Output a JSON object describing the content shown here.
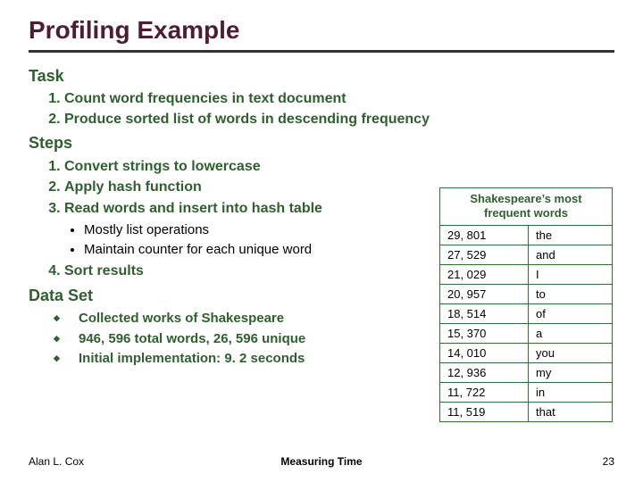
{
  "title": "Profiling Example",
  "sections": {
    "task": {
      "heading": "Task",
      "items": [
        "Count word frequencies in text document",
        "Produce sorted list of words in descending frequency"
      ]
    },
    "steps": {
      "heading": "Steps",
      "items": [
        {
          "text": "Convert strings to lowercase"
        },
        {
          "text": "Apply hash function"
        },
        {
          "text": "Read words and insert into hash table",
          "sub": [
            "Mostly list operations",
            "Maintain counter for each unique word"
          ]
        },
        {
          "text": "Sort results"
        }
      ]
    },
    "dataset": {
      "heading": "Data Set",
      "items": [
        "Collected works of Shakespeare",
        "946, 596 total words, 26, 596 unique",
        "Initial implementation: 9. 2 seconds"
      ]
    }
  },
  "freq_table": {
    "caption": "Shakespeare’s most frequent words",
    "rows": [
      {
        "count": "29, 801",
        "word": "the"
      },
      {
        "count": "27, 529",
        "word": "and"
      },
      {
        "count": "21, 029",
        "word": "I"
      },
      {
        "count": "20, 957",
        "word": "to"
      },
      {
        "count": "18, 514",
        "word": "of"
      },
      {
        "count": "15, 370",
        "word": "a"
      },
      {
        "count": "14, 010",
        "word": "you"
      },
      {
        "count": "12, 936",
        "word": "my"
      },
      {
        "count": "11, 722",
        "word": "in"
      },
      {
        "count": "11, 519",
        "word": "that"
      }
    ]
  },
  "footer": {
    "author": "Alan L. Cox",
    "center": "Measuring Time",
    "page": "23"
  }
}
